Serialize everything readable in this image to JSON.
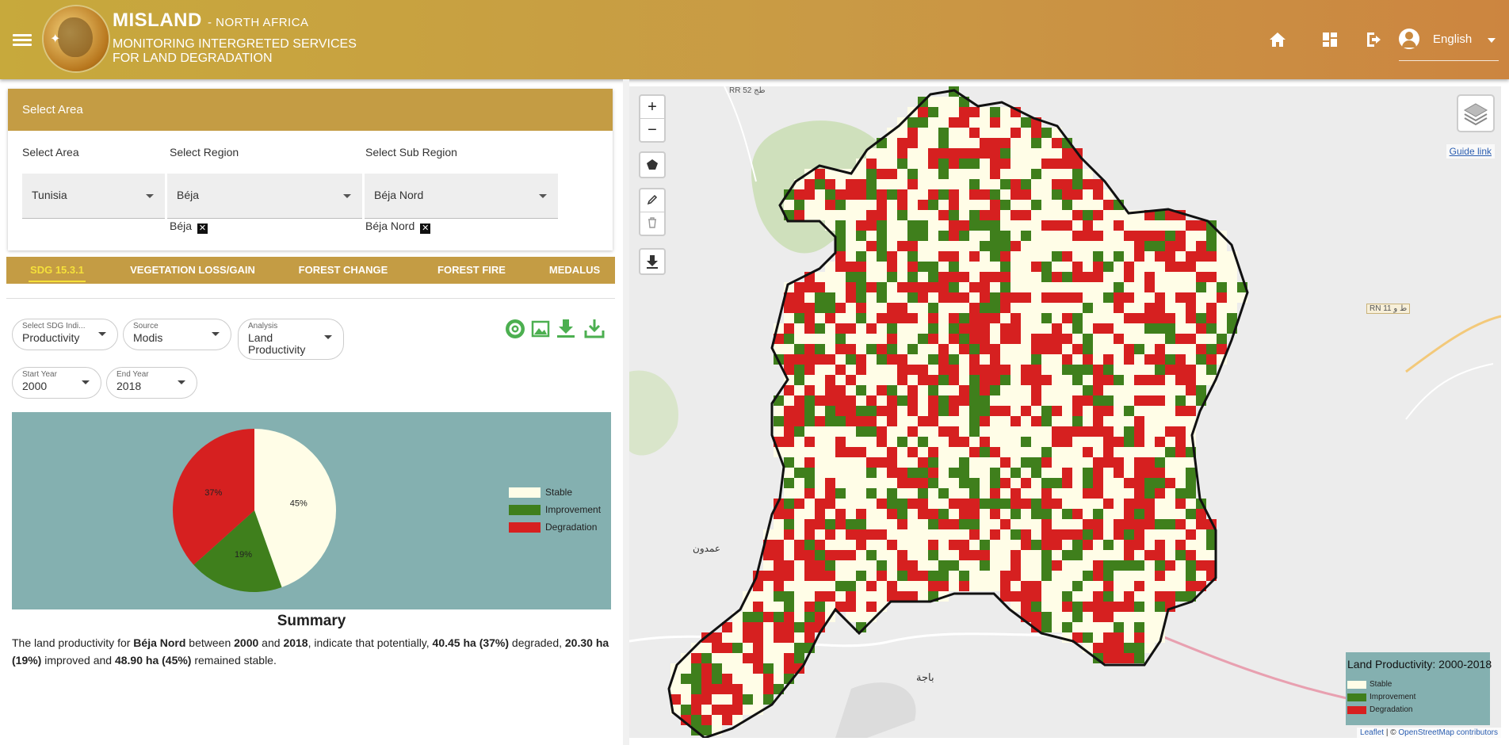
{
  "header": {
    "app_name": "MISLAND",
    "region_suffix": "- NORTH AFRICA",
    "subtitle_line1": "MONITORING INTERGRETED SERVICES",
    "subtitle_line2": "FOR LAND DEGRADATION",
    "logo_text": "MISLAND - مسلاند",
    "language": "English",
    "icons": [
      "menu-icon",
      "home-icon",
      "dashboard-icon",
      "logout-icon",
      "account-icon"
    ]
  },
  "area_panel": {
    "title": "Select Area",
    "area_label": "Select Area",
    "region_label": "Select Region",
    "subregion_label": "Select Sub Region",
    "area_value": "Tunisia",
    "region_value": "Béja",
    "subregion_value": "Béja Nord",
    "region_chip": "Béja",
    "subregion_chip": "Béja Nord",
    "chip_close": "✕"
  },
  "tabs": [
    "SDG 15.3.1",
    "VEGETATION LOSS/GAIN",
    "FOREST CHANGE",
    "FOREST FIRE",
    "MEDALUS"
  ],
  "active_tab": "SDG 15.3.1",
  "filters": {
    "indicator_label": "Select SDG Indi...",
    "indicator_value": "Productivity",
    "source_label": "Source",
    "source_value": "Modis",
    "analysis_label": "Analysis",
    "analysis_value": "Land Productivity",
    "start_label": "Start Year",
    "start_value": "2000",
    "end_label": "End Year",
    "end_value": "2018"
  },
  "tool_icons": [
    "settings-icon",
    "image-icon",
    "download-icon",
    "export-icon"
  ],
  "chart_data": {
    "type": "pie",
    "categories": [
      "Stable",
      "Improvement",
      "Degradation"
    ],
    "values": [
      45,
      19,
      37
    ],
    "labels": [
      "45%",
      "19%",
      "37%"
    ],
    "colors": [
      "#fffde7",
      "#3f7f1c",
      "#d62020"
    ],
    "legend_position": "right"
  },
  "summary": {
    "title": "Summary",
    "t1": "The land productivity for ",
    "place": "Béja Nord",
    "t2": " between ",
    "y1": "2000",
    "t3": " and ",
    "y2": "2018",
    "t4": ", indicate that potentially, ",
    "deg": "40.45 ha (37%)",
    "t5": " degraded, ",
    "imp": "20.30 ha (19%)",
    "t6": " improved and ",
    "stab": "48.90 ha (45%)",
    "t7": " remained stable."
  },
  "map": {
    "zoom_in": "+",
    "zoom_out": "−",
    "guide_link": "Guide link",
    "legend_title": "Land Productivity: 2000-2018",
    "legend_items": [
      "Stable",
      "Improvement",
      "Degradation"
    ],
    "attribution_leaflet": "Leaflet",
    "attribution_sep": " | © ",
    "attribution_osm": "OpenStreetMap contributors",
    "place_labels": [
      "RR 52 طج",
      "باجة",
      "عمدون",
      "RN 11 ط و"
    ]
  }
}
